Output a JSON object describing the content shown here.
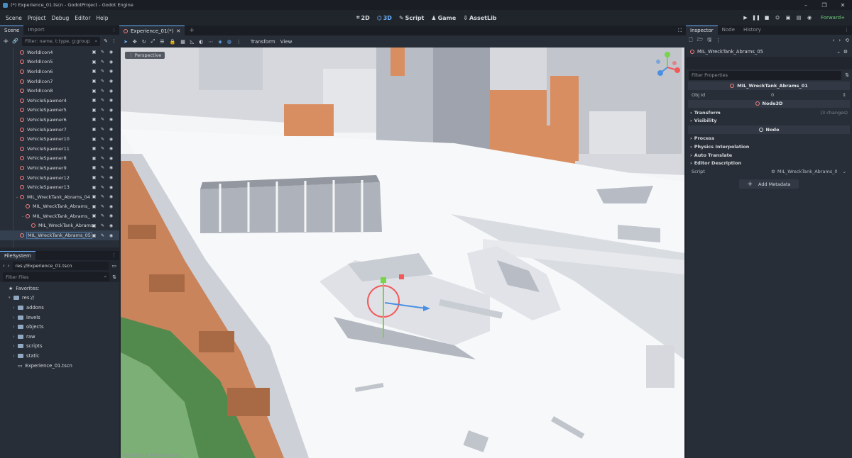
{
  "window": {
    "title": "(*) Experience_01.tscn - GodotProject - Godot Engine"
  },
  "menu": [
    "Scene",
    "Project",
    "Debug",
    "Editor",
    "Help"
  ],
  "modes": {
    "m2d": "2D",
    "m3d": "3D",
    "script": "Script",
    "game": "Game",
    "assetlib": "AssetLib"
  },
  "renderer": "Forward+",
  "scene_dock": {
    "tabs": [
      "Scene",
      "Import"
    ],
    "filter_placeholder": "Filter: name, t:type, g:group",
    "nodes": [
      {
        "label": "WorldIcon4",
        "depth": 0
      },
      {
        "label": "WorldIcon5",
        "depth": 0
      },
      {
        "label": "WorldIcon6",
        "depth": 0
      },
      {
        "label": "WorldIcon7",
        "depth": 0
      },
      {
        "label": "WorldIcon8",
        "depth": 0
      },
      {
        "label": "VehicleSpawner4",
        "depth": 0
      },
      {
        "label": "VehicleSpawner5",
        "depth": 0
      },
      {
        "label": "VehicleSpawner6",
        "depth": 0
      },
      {
        "label": "VehicleSpawner7",
        "depth": 0
      },
      {
        "label": "VehicleSpawner10",
        "depth": 0
      },
      {
        "label": "VehicleSpawner11",
        "depth": 0
      },
      {
        "label": "VehicleSpawner8",
        "depth": 0
      },
      {
        "label": "VehicleSpawner9",
        "depth": 0
      },
      {
        "label": "VehicleSpawner12",
        "depth": 0
      },
      {
        "label": "VehicleSpawner13",
        "depth": 0
      },
      {
        "label": "MIL_WreckTank_Abrams_04",
        "depth": 0
      },
      {
        "label": "MIL_WreckTank_Abrams_",
        "depth": 1
      },
      {
        "label": "MIL_WreckTank_Abrams_",
        "depth": 1
      },
      {
        "label": "MIL_WreckTank_Abrams",
        "depth": 2
      },
      {
        "label": "MIL_WreckTank_Abrams_05",
        "depth": 0,
        "selected": true
      }
    ]
  },
  "filesystem": {
    "title": "FileSystem",
    "path": "res://Experience_01.tscn",
    "filter_placeholder": "Filter Files",
    "favorites": "Favorites:",
    "root": "res://",
    "folders": [
      "addons",
      "levels",
      "objects",
      "raw",
      "scripts",
      "static"
    ],
    "file": "Experience_01.tscn"
  },
  "editor": {
    "tab": "Experience_01(*)",
    "transform_menu": "Transform",
    "view_menu": "View",
    "perspective": "Perspective",
    "rotation_info": "Rotation: 4.820 degrees"
  },
  "inspector": {
    "tabs": [
      "Inspector",
      "Node",
      "History"
    ],
    "object_name": "MIL_WreckTank_Abrams_05",
    "filter_placeholder": "Filter Properties",
    "section_main": "MIL_WreckTank_Abrams_01",
    "obj_id_label": "Obj Id",
    "obj_id_value": "0",
    "section_node3d": "Node3D",
    "transform": "Transform",
    "transform_changes": "(3 changes)",
    "visibility": "Visibility",
    "section_node": "Node",
    "process": "Process",
    "physics_interpolation": "Physics Interpolation",
    "auto_translate": "Auto Translate",
    "editor_description": "Editor Description",
    "script_label": "Script",
    "script_value": "MIL_WreckTank_Abrams_0",
    "add_metadata": "Add Metadata"
  },
  "colors": {
    "accent": "#6cb2ff",
    "node_icon": "#fc7f7f",
    "sand": "#d98e62",
    "ground": "#f4f5f7"
  }
}
